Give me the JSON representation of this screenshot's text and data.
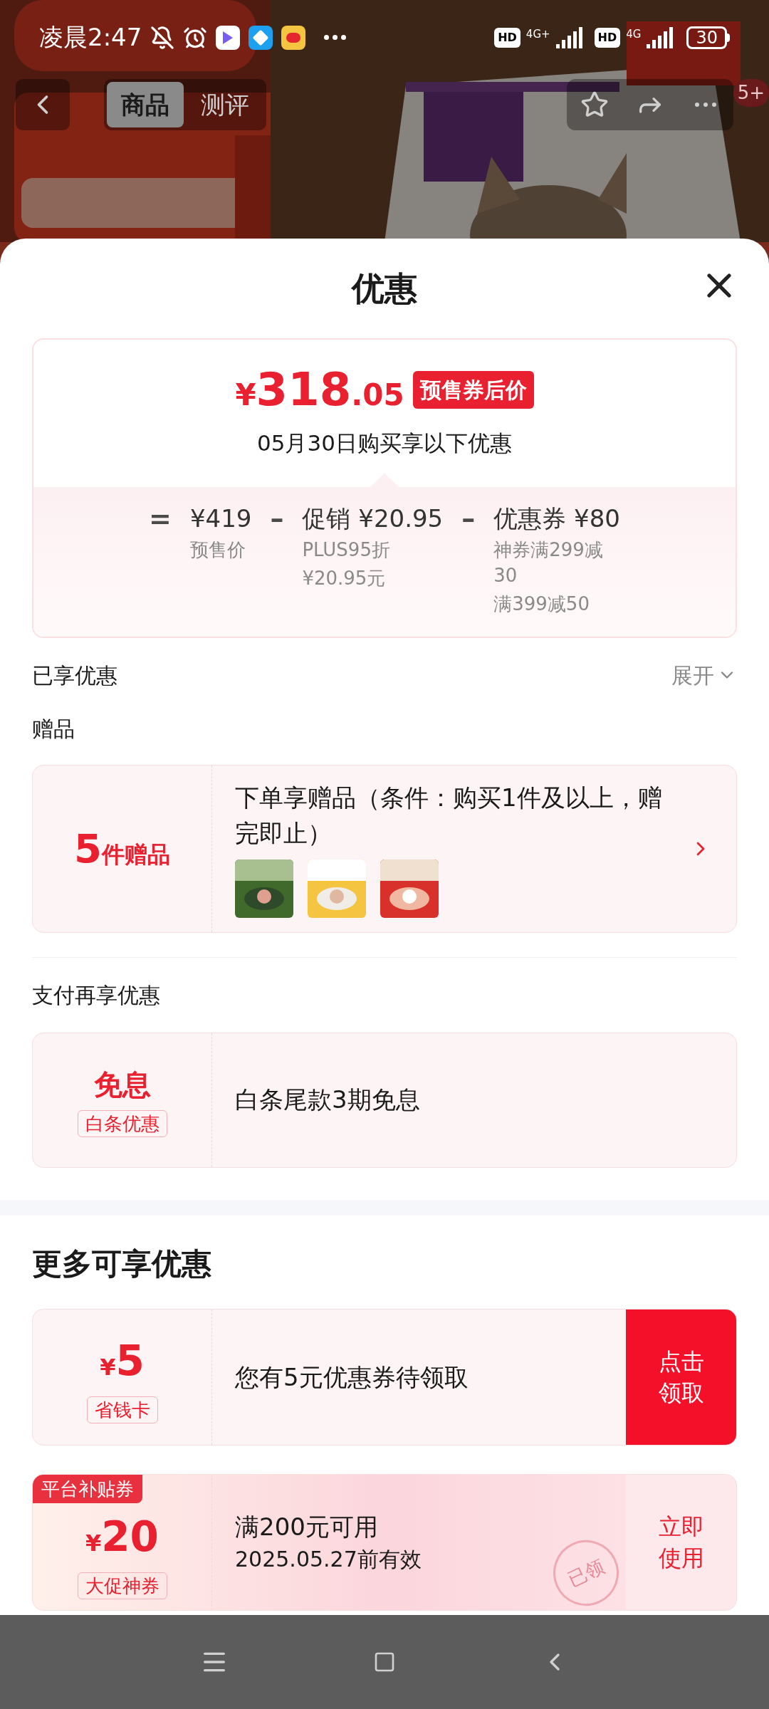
{
  "status_bar": {
    "time": "凌晨2:47",
    "hd_1": "HD",
    "network_1": "4G+",
    "hd_2": "HD",
    "network_2": "4G",
    "battery": "30"
  },
  "header": {
    "tabs": [
      {
        "label": "商品",
        "selected": true
      },
      {
        "label": "测评",
        "selected": false
      }
    ],
    "badge": "5+"
  },
  "sheet": {
    "title": "优惠",
    "price": {
      "currency": "¥",
      "integer": "318",
      "decimal": ".05",
      "tag": "预售券后价",
      "note": "05月30日购买享以下优惠"
    },
    "breakdown": [
      {
        "operator": "=",
        "amount": "¥419",
        "details": [
          "预售价"
        ]
      },
      {
        "operator": "–",
        "amount": "促销 ¥20.95",
        "details": [
          "PLUS95折",
          "¥20.95元"
        ]
      },
      {
        "operator": "–",
        "amount": "优惠券 ¥80",
        "details": [
          "神券满299减30",
          "满399减50"
        ]
      }
    ],
    "enjoyed": {
      "title": "已享优惠",
      "toggle": "展开"
    },
    "gifts": {
      "title": "赠品",
      "count": "5",
      "unit": "件赠品",
      "description": "下单享赠品（条件：购买1件及以上，赠完即止）"
    },
    "payment": {
      "title": "支付再享优惠",
      "offers": [
        {
          "headline": "免息",
          "tag": "白条优惠",
          "text": "白条尾款3期免息"
        }
      ]
    },
    "more": {
      "title": "更多可享优惠",
      "coupons": [
        {
          "kind": "card",
          "currency": "¥",
          "amount": "5",
          "tag": "省钱卡",
          "lines": [
            "您有5元优惠券待领取"
          ],
          "action": "点击领取",
          "claimed": false
        },
        {
          "kind": "platform",
          "ribbon": "平台补贴券",
          "currency": "¥",
          "amount": "20",
          "tag": "大促神券",
          "lines": [
            "满200元可用",
            "2025.05.27前有效"
          ],
          "action": "立即使用",
          "claimed": true,
          "stamp": "已领"
        }
      ]
    }
  }
}
